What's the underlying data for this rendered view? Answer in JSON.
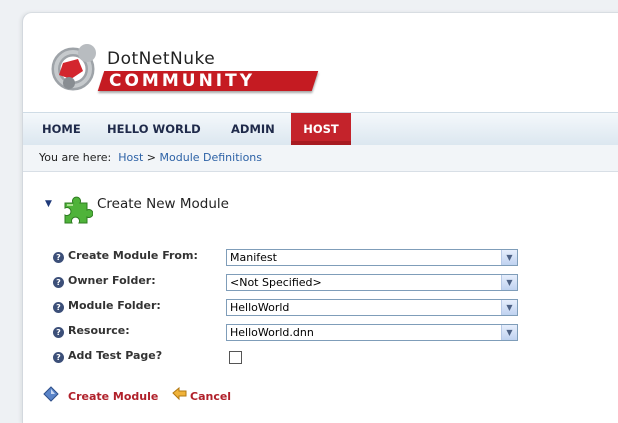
{
  "logo": {
    "line1": "DotNetNuke",
    "line2": "COMMUNITY"
  },
  "nav": {
    "items": [
      "HOME",
      "HELLO WORLD",
      "ADMIN",
      "HOST"
    ],
    "active": "HOST"
  },
  "breadcrumb": {
    "label": "You are here:",
    "items": [
      "Host",
      "Module Definitions"
    ],
    "separator": ">"
  },
  "section": {
    "title": "Create New Module"
  },
  "form": {
    "create_from": {
      "label": "Create Module From:",
      "value": "Manifest"
    },
    "owner_folder": {
      "label": "Owner Folder:",
      "value": "<Not Specified>"
    },
    "module_folder": {
      "label": "Module Folder:",
      "value": "HelloWorld"
    },
    "resource": {
      "label": "Resource:",
      "value": "HelloWorld.dnn"
    },
    "add_test_page": {
      "label": "Add Test Page?",
      "checked": false
    }
  },
  "actions": {
    "create": "Create Module",
    "cancel": "Cancel"
  },
  "colors": {
    "accent_red": "#c4232b",
    "link_blue": "#2d62a6",
    "nav_text": "#1f2a4a"
  },
  "icons": [
    "dnn-logo-icon",
    "collapse-arrow-icon",
    "puzzle-icon",
    "help-icon",
    "dropdown-arrow-icon",
    "diamond-icon",
    "cancel-arrow-icon"
  ]
}
